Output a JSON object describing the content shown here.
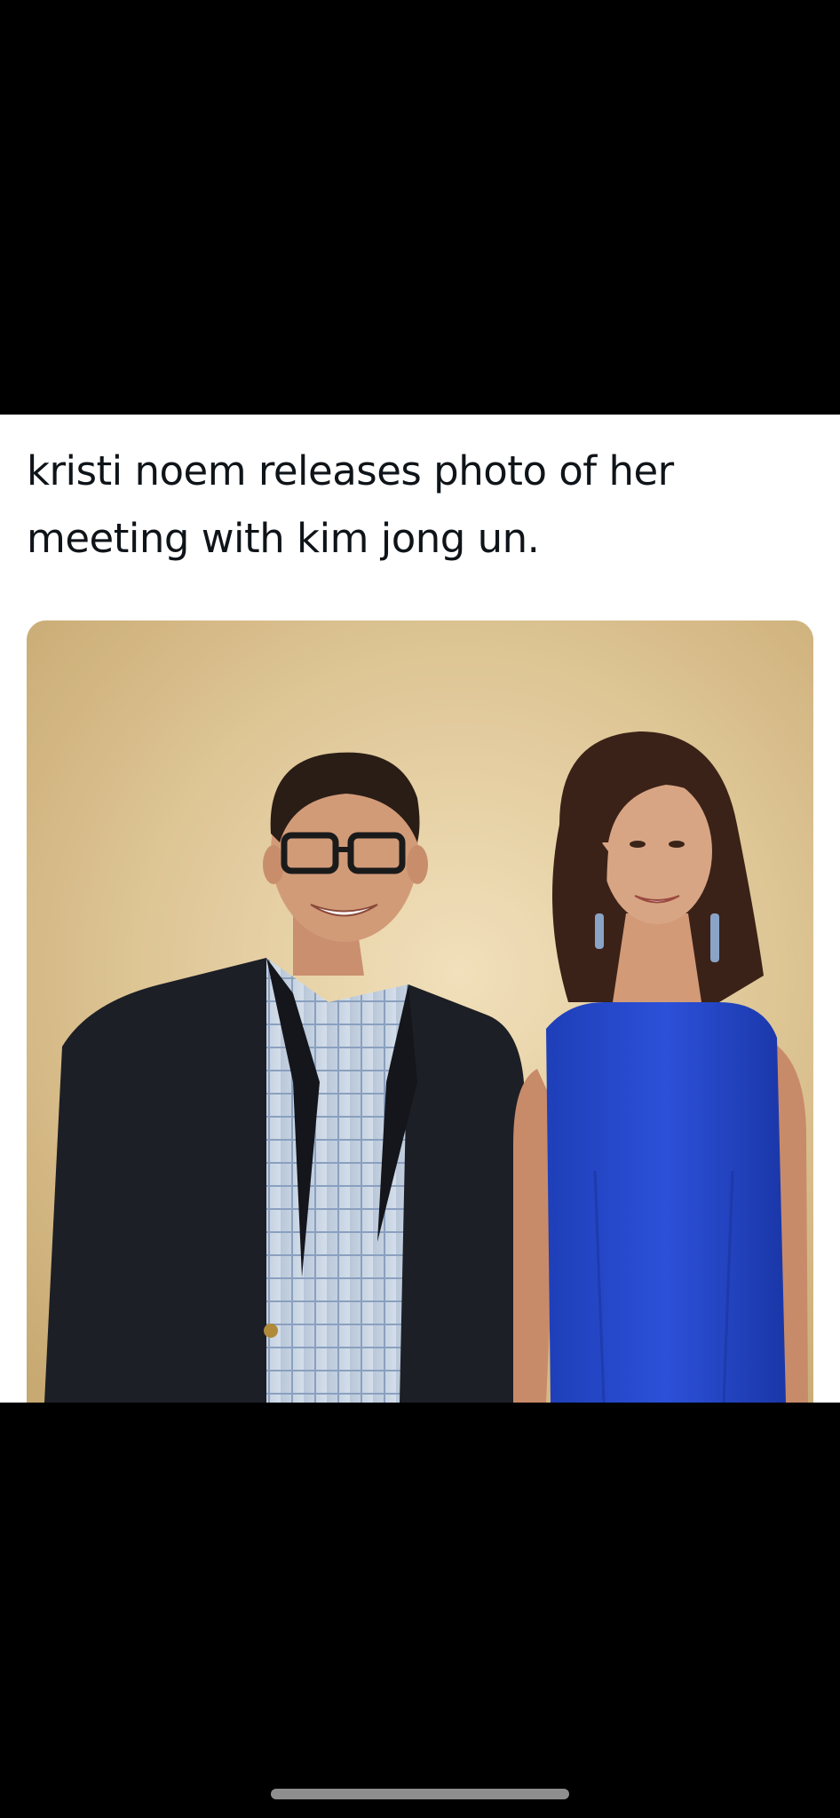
{
  "post": {
    "text": "kristi noem releases photo of her meeting with kim jong un."
  },
  "image": {
    "icon": "photo-of-two-people"
  },
  "colors": {
    "background": "#000000",
    "card": "#ffffff",
    "text": "#0f1419",
    "home_indicator": "#8e8e8e"
  }
}
